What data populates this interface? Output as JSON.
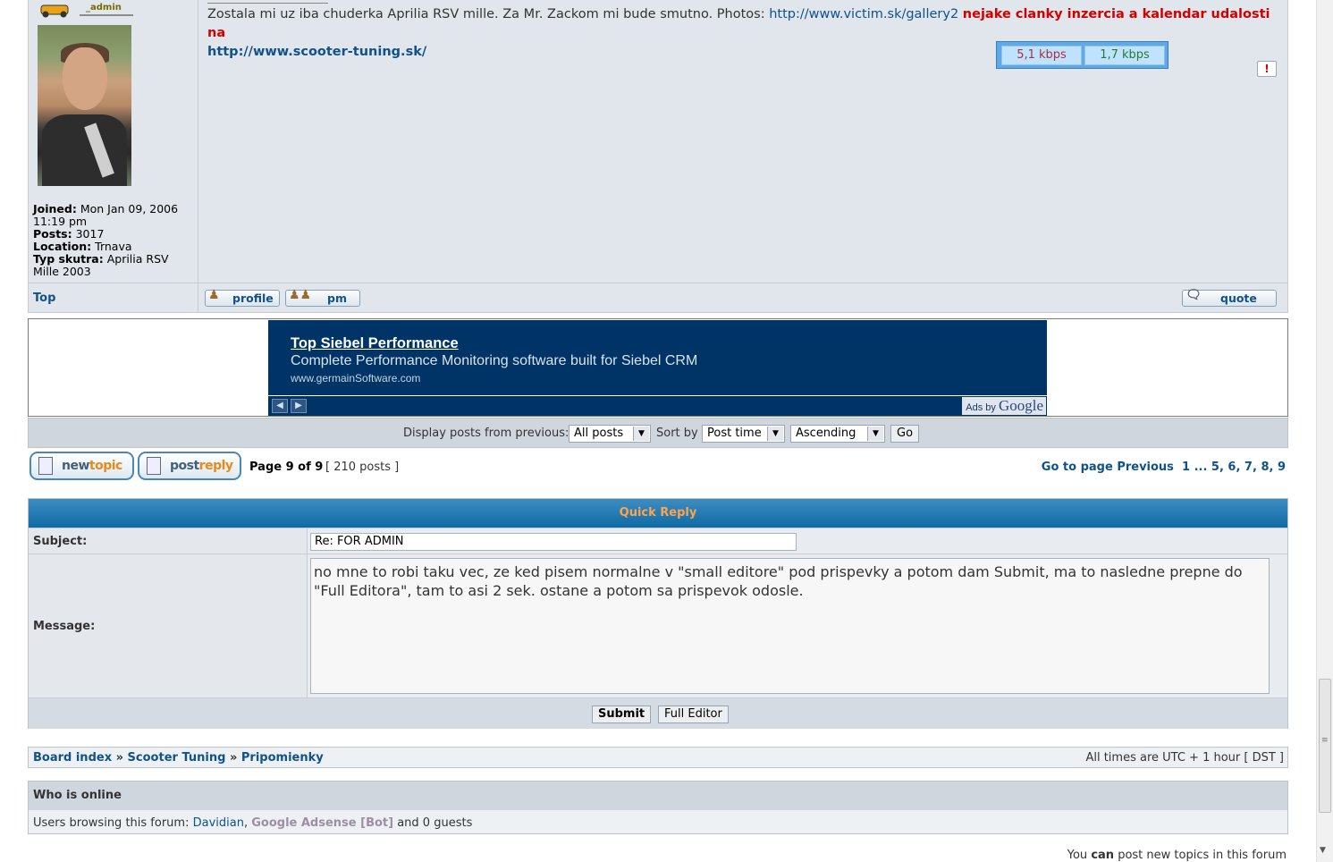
{
  "post": {
    "rank": "_admin",
    "profile": {
      "joined_label": "Joined:",
      "joined": "Mon Jan 09, 2006 11:19 pm",
      "posts_label": "Posts:",
      "posts": "3017",
      "location_label": "Location:",
      "location": "Trnava",
      "type_label": "Typ skutra:",
      "type": "Aprilia RSV Mille 2003"
    },
    "text_plain": "Zostala mi uz iba chuderka Aprilia RSV mille. Za Mr. Zackom mi bude smutno. Photos:",
    "link_gallery": "http://www.victim.sk/gallery2",
    "text_red": "nejake clanky inzercia a kalendar udalosti na",
    "link_site": "http://www.scooter-tuning.sk/",
    "kbps_left": "5,1 kbps",
    "kbps_right": "1,7 kbps",
    "report_icon": "!",
    "top_link": "Top",
    "profile_btn": "profile",
    "pm_btn": "pm",
    "quote_btn": "quote"
  },
  "ad": {
    "title": "Top Siebel Performance",
    "description": "Complete Performance Monitoring software built for Siebel CRM",
    "url": "www.germainSoftware.com",
    "ads_by": "Ads by",
    "google": "Google"
  },
  "sortbar": {
    "display_label": "Display posts from previous:",
    "display_value": "All posts",
    "sort_label": "Sort by",
    "sort_value": "Post time",
    "order_value": "Ascending",
    "go": "Go"
  },
  "pagination": {
    "newtopic_a": "new",
    "newtopic_b": "topic",
    "postreply_a": "post",
    "postreply_b": "reply",
    "page_info": "Page 9 of 9",
    "post_count": "[ 210 posts ]",
    "goto_label": "Go to page",
    "previous": "Previous",
    "pages": "1 ... 5, 6, 7, 8, 9"
  },
  "quick_reply": {
    "title": "Quick Reply",
    "subject_label": "Subject:",
    "subject_value": "Re: FOR ADMIN",
    "message_label": "Message:",
    "message_value": "no mne to robi taku vec, ze ked pisem normalne v \"small editore\" pod prispevky a potom dam Submit, ma to nasledne prepne do \"Full Editora\", tam to asi 2 sek. ostane a potom sa prispevok odosle.",
    "submit": "Submit",
    "full_editor": "Full Editor"
  },
  "breadcrumb": {
    "board_index": "Board index",
    "sep": "»",
    "forum": "Scooter Tuning",
    "subforum": "Pripomienky",
    "timezone": "All times are UTC + 1 hour [ DST ]"
  },
  "online": {
    "title": "Who is online",
    "prefix": "Users browsing this forum:",
    "user1": "Davidian",
    "user2": "Google Adsense [Bot]",
    "suffix": "and 0 guests"
  },
  "permissions": {
    "line_a": "You",
    "line_b": "can",
    "line_c": "post new topics in this forum"
  }
}
